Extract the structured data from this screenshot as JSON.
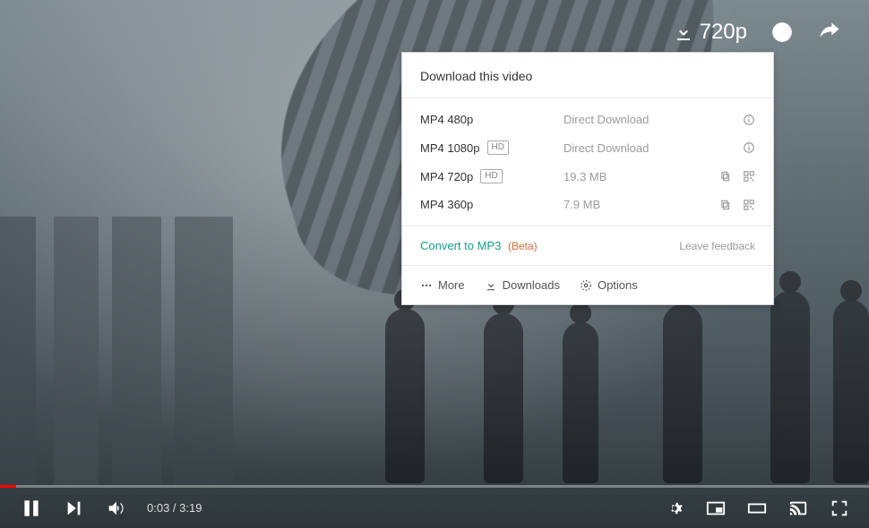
{
  "top": {
    "quality": "720p"
  },
  "panel": {
    "title": "Download this video",
    "rows": [
      {
        "format": "MP4 480p",
        "hd": false,
        "size": "Direct Download",
        "icons": "info"
      },
      {
        "format": "MP4 1080p",
        "hd": true,
        "size": "Direct Download",
        "icons": "info"
      },
      {
        "format": "MP4 720p",
        "hd": true,
        "size": "19.3 MB",
        "icons": "copyqr"
      },
      {
        "format": "MP4 360p",
        "hd": false,
        "size": "7.9 MB",
        "icons": "copyqr"
      }
    ],
    "convert_label": "Convert to MP3",
    "beta_label": "(Beta)",
    "feedback_label": "Leave feedback",
    "footer": {
      "more": "More",
      "downloads": "Downloads",
      "options": "Options"
    },
    "hd_badge": "HD"
  },
  "controls": {
    "time": "0:03 / 3:19"
  }
}
